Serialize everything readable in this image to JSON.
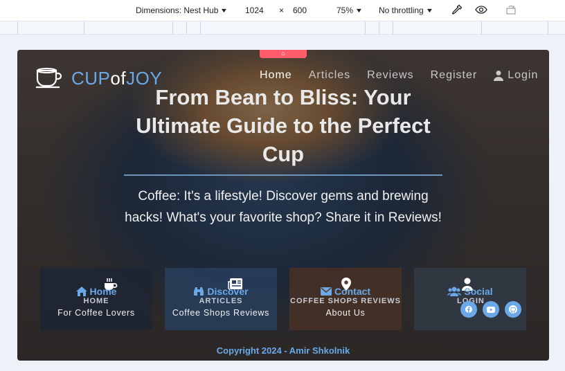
{
  "devtools": {
    "dimensions_label": "Dimensions: Nest Hub",
    "width": "1024",
    "times": "×",
    "height": "600",
    "zoom": "75%",
    "throttling": "No throttling",
    "icons": [
      "eyedropper-icon",
      "eye-icon",
      "rotate-icon"
    ]
  },
  "site": {
    "logo": {
      "cup": "CUP",
      "of": "of",
      "joy": "JOY",
      "icon": "coffee-cup-icon"
    },
    "nav": [
      "Home",
      "Articles",
      "Reviews",
      "Register",
      "Login"
    ],
    "hero": {
      "title": "From Bean to Bliss: Your Ultimate Guide to the Perfect Cup",
      "subtitle": "Coffee: It's a lifestyle! Discover gems and brewing hacks! What's your favorite shop? Share it in Reviews!"
    },
    "cards": [
      {
        "title": "Home",
        "sublabel": "HOME",
        "desc": "For Coffee Lovers",
        "icon": "home-icon"
      },
      {
        "title": "Discover",
        "sublabel": "ARTICLES",
        "desc": "Coffee Shops Reviews",
        "icon": "binoculars-icon"
      },
      {
        "title": "Contact",
        "sublabel": "COFFEE SHOPS REVIEWS",
        "desc": "About Us",
        "icon": "envelope-icon"
      },
      {
        "title": "Social",
        "sublabel": "LOGIN",
        "desc": "",
        "icon": "users-icon"
      }
    ],
    "social_icons": [
      "facebook-icon",
      "youtube-icon",
      "github-icon"
    ],
    "footer": "Copyright 2024 - Amir Shkolnik"
  },
  "colors": {
    "accent": "#6aa8ea",
    "handle": "#ff5c6c"
  }
}
